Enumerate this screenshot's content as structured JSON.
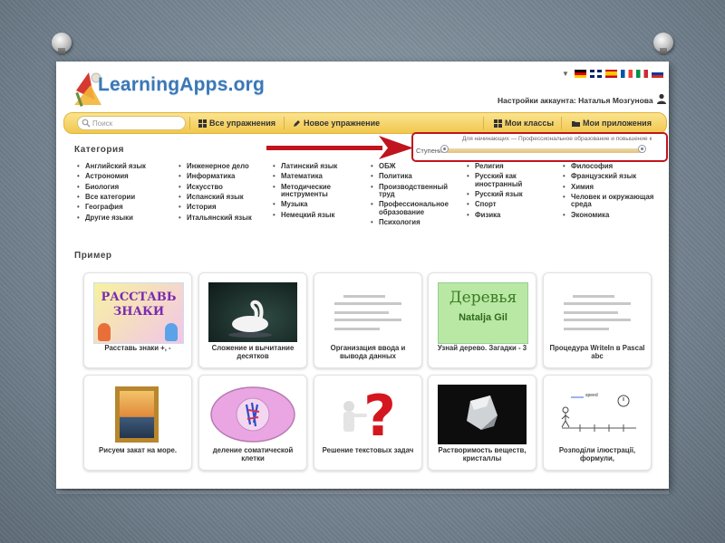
{
  "header": {
    "logo_text": "LearningApps.org",
    "account_label": "Настройки аккаунта: Наталья Мозгунова"
  },
  "languages": [
    "de",
    "en",
    "es",
    "fr",
    "it",
    "ru"
  ],
  "nav": {
    "search_placeholder": "Поиск",
    "all_exercises": "Все упражнения",
    "new_exercise": "Новое упражнение",
    "my_classes": "Мои классы",
    "my_apps": "Мои приложения"
  },
  "category": {
    "title": "Категория",
    "columns": [
      [
        "Английский язык",
        "Астрономия",
        "Биология",
        "Все категории",
        "География",
        "Другие языки"
      ],
      [
        "Инженерное дело",
        "Информатика",
        "Искусство",
        "Испанский язык",
        "История",
        "Итальянский язык"
      ],
      [
        "Латинский язык",
        "Математика",
        "Методические инструменты",
        "Музыка",
        "Немецкий язык"
      ],
      [
        "ОБЖ",
        "Политика",
        "Производственный труд",
        "Профессиональное образование",
        "Психология"
      ],
      [
        "Религия",
        "Русский как иностранный",
        "Русский язык",
        "Спорт",
        "Физика"
      ],
      [
        "Философия",
        "Французский язык",
        "Химия",
        "Человек и окружающая среда",
        "Экономика"
      ]
    ]
  },
  "levels": {
    "scale_text": "Для начинающих — Профессиональное образование и повышение к",
    "label": "Ступени:",
    "min": 0,
    "max": 1
  },
  "examples": {
    "title": "Пример",
    "cards": [
      {
        "caption": "Расставь знаки +, -",
        "thumb_text": "РАССТАВЬ ЗНАКИ"
      },
      {
        "caption": "Сложение и вычитание десятков"
      },
      {
        "caption": "Организация ввода и вывода данных"
      },
      {
        "caption": "Узнай дерево. Загадки - 3",
        "thumb_text": "Деревья",
        "thumb_sub": "Natalja Gil"
      },
      {
        "caption": "Процедура WriteIn в Pascal abc"
      },
      {
        "caption": "Рисуем закат на море."
      },
      {
        "caption": "деление соматической клетки"
      },
      {
        "caption": "Решение текстовых задач"
      },
      {
        "caption": "Растворимость веществ, кристаллы"
      },
      {
        "caption": "Розподіли ілюстрації, формули,",
        "thumb_text": "speed"
      }
    ]
  },
  "colors": {
    "logo_blue": "#3b78b6",
    "nav_yellow": "#f1c84d",
    "highlight_red": "#c0141e"
  }
}
